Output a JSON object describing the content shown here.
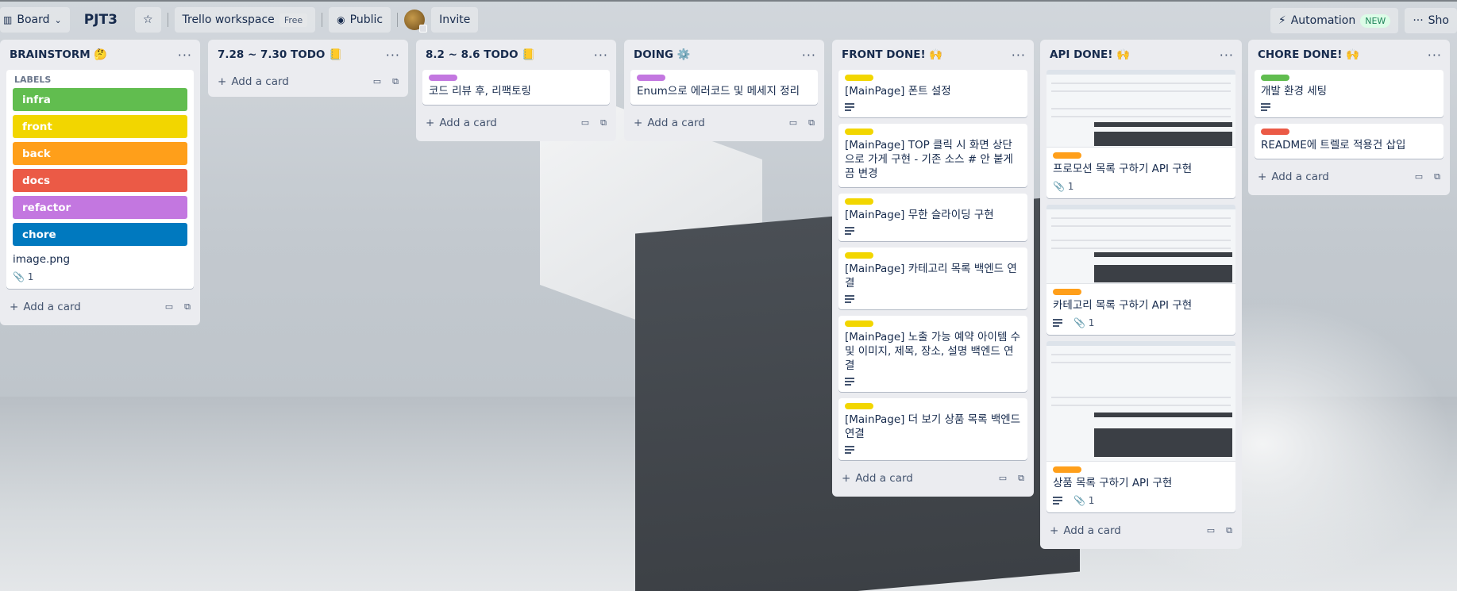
{
  "topbar": {
    "board_button": "Board",
    "board_title": "PJT3",
    "workspace": "Trello workspace",
    "workspace_badge": "Free",
    "visibility": "Public",
    "invite": "Invite",
    "automation": "Automation",
    "automation_badge": "NEW",
    "show": "Sho"
  },
  "lists": [
    {
      "title": "BRAINSTORM 🤔",
      "labels_title": "LABELS",
      "labels": [
        {
          "name": "infra",
          "color": "#61bd4f"
        },
        {
          "name": "front",
          "color": "#f2d600"
        },
        {
          "name": "back",
          "color": "#ff9f1a"
        },
        {
          "name": "docs",
          "color": "#eb5a46"
        },
        {
          "name": "refactor",
          "color": "#c377e0"
        },
        {
          "name": "chore",
          "color": "#0079bf"
        }
      ],
      "attachment_name": "image.png",
      "attachment_count": "1",
      "add": "Add a card"
    },
    {
      "title": "7.28 ~ 7.30 TODO 📒",
      "add": "Add a card"
    },
    {
      "title": "8.2 ~ 8.6 TODO 📒",
      "cards": [
        {
          "text": "코드 리뷰 후, 리팩토링",
          "label": "#c377e0"
        }
      ],
      "add": "Add a card"
    },
    {
      "title": "DOING ⚙️",
      "cards": [
        {
          "text": "Enum으로 에러코드 및 메세지 정리",
          "label": "#c377e0"
        }
      ],
      "add": "Add a card"
    },
    {
      "title": "FRONT DONE! 🙌",
      "cards": [
        {
          "text": "[MainPage] 폰트 설정",
          "label": "#f2d600"
        },
        {
          "text": "[MainPage] TOP 클릭 시 화면 상단으로 가게 구현 - 기존 소스 # 안 붙게끔 변경",
          "label": "#f2d600"
        },
        {
          "text": "[MainPage] 무한 슬라이딩 구현",
          "label": "#f2d600"
        },
        {
          "text": "[MainPage] 카테고리 목록 백엔드 연결",
          "label": "#f2d600"
        },
        {
          "text": "[MainPage] 노출 가능 예약 아이템 수 및 이미지, 제목, 장소, 설명 백엔드 연결",
          "label": "#f2d600"
        },
        {
          "text": "[MainPage] 더 보기 상품 목록 백엔드 연결",
          "label": "#f2d600"
        }
      ],
      "add": "Add a card"
    },
    {
      "title": "API DONE! 🙌",
      "cards": [
        {
          "text": "프로모션 목록 구하기 API 구현",
          "label": "#ff9f1a",
          "attachments": "1"
        },
        {
          "text": "카테고리 목록 구하기 API 구현",
          "label": "#ff9f1a",
          "attachments": "1"
        },
        {
          "text": "상품 목록 구하기 API 구현",
          "label": "#ff9f1a",
          "attachments": "1"
        }
      ],
      "add": "Add a card"
    },
    {
      "title": "CHORE DONE! 🙌",
      "cards": [
        {
          "text": "개발 환경 세팅",
          "label": "#61bd4f"
        },
        {
          "text": "README에 트렐로 적용건 삽입",
          "label": "#eb5a46"
        }
      ],
      "add": "Add a card"
    }
  ]
}
